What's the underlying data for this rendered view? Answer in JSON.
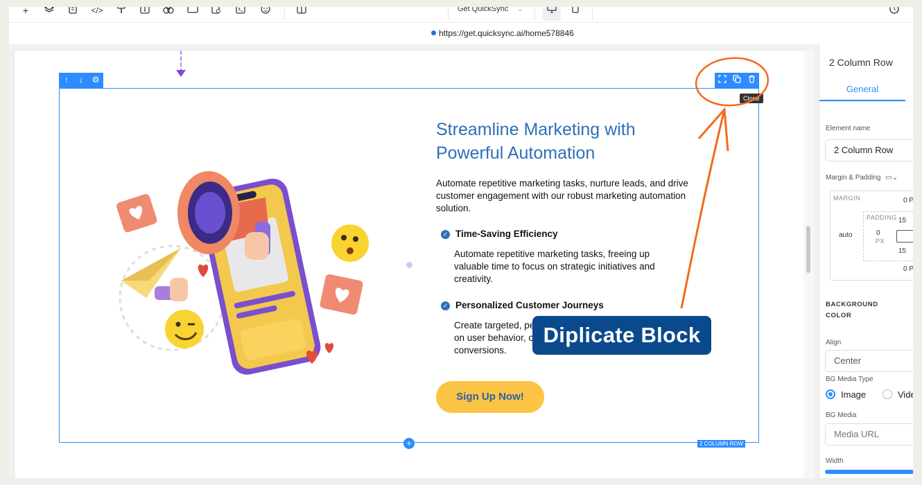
{
  "toolbar": {
    "icons": [
      "plus-icon",
      "layers-icon",
      "page-icon",
      "code-icon",
      "paint-icon",
      "text-icon",
      "components-icon",
      "section-icon",
      "form-icon",
      "terminal-icon",
      "emoji-icon",
      "columns-icon"
    ],
    "site_select": "Get QuickSync",
    "history_icon": "history-icon"
  },
  "url": "https://get.quicksync.ai/home578846",
  "row": {
    "tooltip": "Clone",
    "tag": "2 COLUMN ROW"
  },
  "hero": {
    "title": "Streamline Marketing with Powerful Automation",
    "description": "Automate repetitive marketing tasks, nurture leads, and drive customer engagement with our robust marketing automation solution.",
    "features": [
      {
        "title": "Time-Saving Efficiency",
        "desc": "Automate repetitive marketing tasks, freeing up valuable time to focus on strategic initiatives and creativity."
      },
      {
        "title": "Personalized Customer Journeys",
        "desc": "Create targeted, pe... on user behavior, o... conversions."
      }
    ],
    "feature2_line1": "Create targeted, pe",
    "feature2_line2": "on user behavior, o",
    "feature2_line3": "conversions.",
    "cta": "Sign Up Now!"
  },
  "annotation": {
    "label": "Diplicate Block",
    "color": "#f26a1b"
  },
  "panel": {
    "title": "2 Column Row",
    "tab": "General",
    "element_name_label": "Element name",
    "element_name_value": "2 Column Row",
    "margin_padding_label": "Margin & Padding",
    "margin_label": "MARGIN",
    "padding_label": "PADDING",
    "margin_top": "0 P",
    "margin_left": "auto",
    "padding_top": "15",
    "padding_left": "0",
    "padding_unit": "PX",
    "padding_bottom": "15",
    "margin_bottom": "0 P",
    "bg_color_label": "BACKGROUND COLOR",
    "align_label": "Align",
    "align_value": "Center",
    "bg_media_type_label": "BG Media Type",
    "media_image": "Image",
    "media_video": "Vide",
    "bg_media_label": "BG Media",
    "bg_media_placeholder": "Media URL",
    "width_label": "Width"
  },
  "colors": {
    "accent": "#2d8cff",
    "title_blue": "#2e6fb8",
    "cta_yellow": "#fcc444",
    "label_navy": "#0a4a8c"
  }
}
